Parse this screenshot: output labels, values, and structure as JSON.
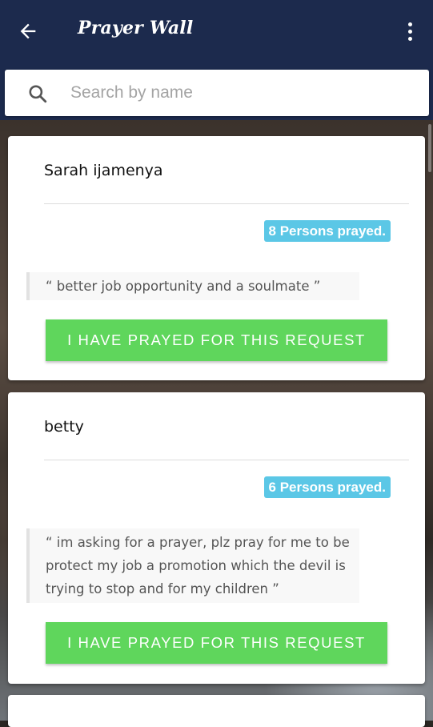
{
  "header": {
    "title": "Prayer Wall",
    "back_icon": "arrow-left-icon",
    "menu_icon": "more-vertical-icon",
    "background_color": "#1c2a4d"
  },
  "search": {
    "placeholder": "Search by name",
    "value": "",
    "icon": "search-icon"
  },
  "requests": [
    {
      "name": "Sarah ijamenya",
      "prayed_count_label": "8 Persons prayed.",
      "request_text": "“ better job opportunity and a soulmate ”",
      "button_label": "I HAVE PRAYED FOR THIS REQUEST"
    },
    {
      "name": "betty",
      "prayed_count_label": "6 Persons prayed.",
      "request_text": "“ im asking for a prayer, plz pray for me to be protect my job a promotion which the devil is trying to stop and for my children ”",
      "button_label": "I HAVE PRAYED FOR THIS REQUEST"
    }
  ],
  "colors": {
    "badge": "#5bc7e6",
    "button": "#5fd65c"
  }
}
